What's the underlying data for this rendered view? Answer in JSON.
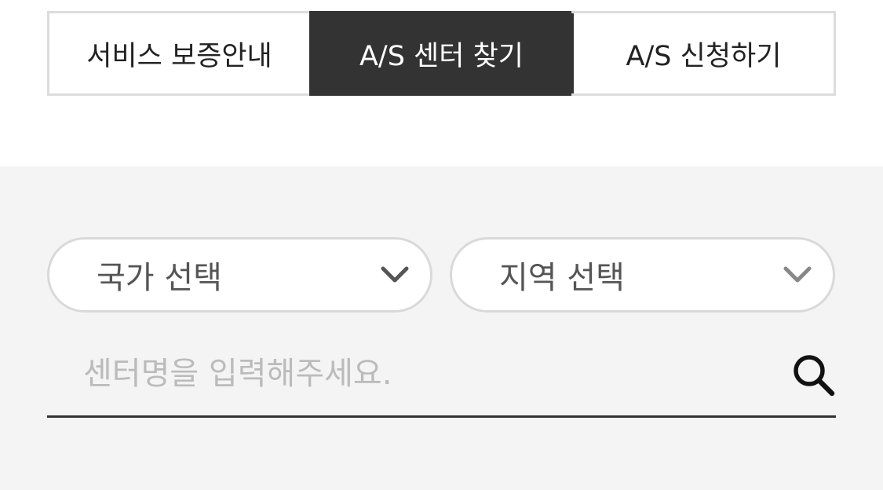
{
  "tabs": [
    {
      "label": "서비스 보증안내",
      "active": false
    },
    {
      "label": "A/S 센터 찾기",
      "active": true
    },
    {
      "label": "A/S 신청하기",
      "active": false
    }
  ],
  "filters": {
    "country_label": "국가 선택",
    "region_label": "지역 선택"
  },
  "search": {
    "placeholder": "센터명을 입력해주세요.",
    "value": "",
    "icon": "search-icon"
  },
  "colors": {
    "active_tab_bg": "#333333",
    "panel_bg": "#f4f4f4",
    "border": "#dcdcdc"
  }
}
